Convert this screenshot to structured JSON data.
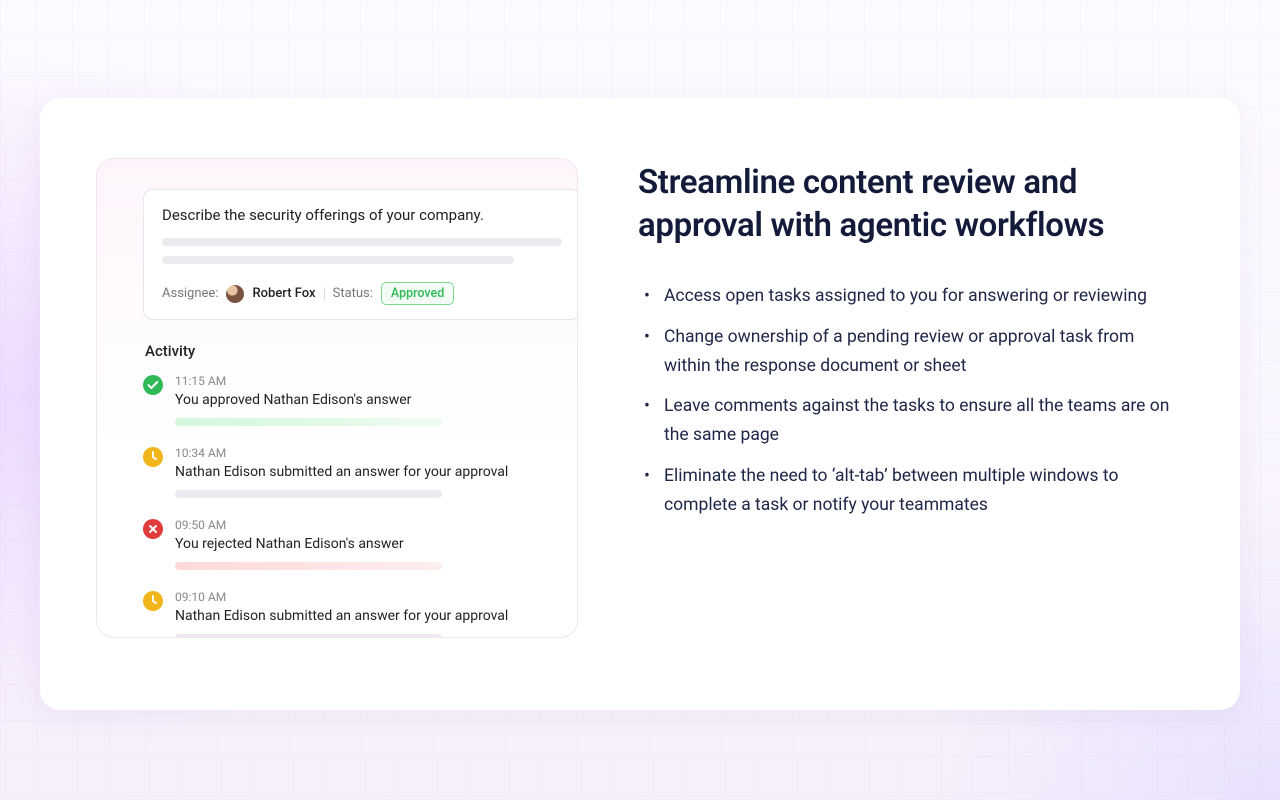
{
  "headline": "Streamline content review and approval with agentic workflows",
  "bullets": [
    "Access open tasks assigned to you for answering or reviewing",
    "Change ownership of a pending review or approval task from within the response document or sheet",
    "Leave comments against the tasks to ensure all the teams are on the same page",
    "Eliminate the need to ‘alt-tab’ between multiple windows to complete a task or notify your teammates"
  ],
  "task": {
    "prompt": "Describe the security offerings of your company.",
    "assignee_label": "Assignee:",
    "assignee_name": "Robert Fox",
    "status_label": "Status:",
    "status_value": "Approved"
  },
  "activity": {
    "heading": "Activity",
    "items": [
      {
        "icon": "check",
        "time": "11:15 AM",
        "text": "You approved Nathan Edison's answer",
        "bar": "green"
      },
      {
        "icon": "clock",
        "time": "10:34 AM",
        "text": "Nathan Edison submitted an answer for your approval",
        "bar": "grey"
      },
      {
        "icon": "x",
        "time": "09:50 AM",
        "text": "You rejected Nathan Edison's answer",
        "bar": "red"
      },
      {
        "icon": "clock",
        "time": "09:10 AM",
        "text": "Nathan Edison submitted an answer for your approval",
        "bar": "grey"
      }
    ]
  }
}
